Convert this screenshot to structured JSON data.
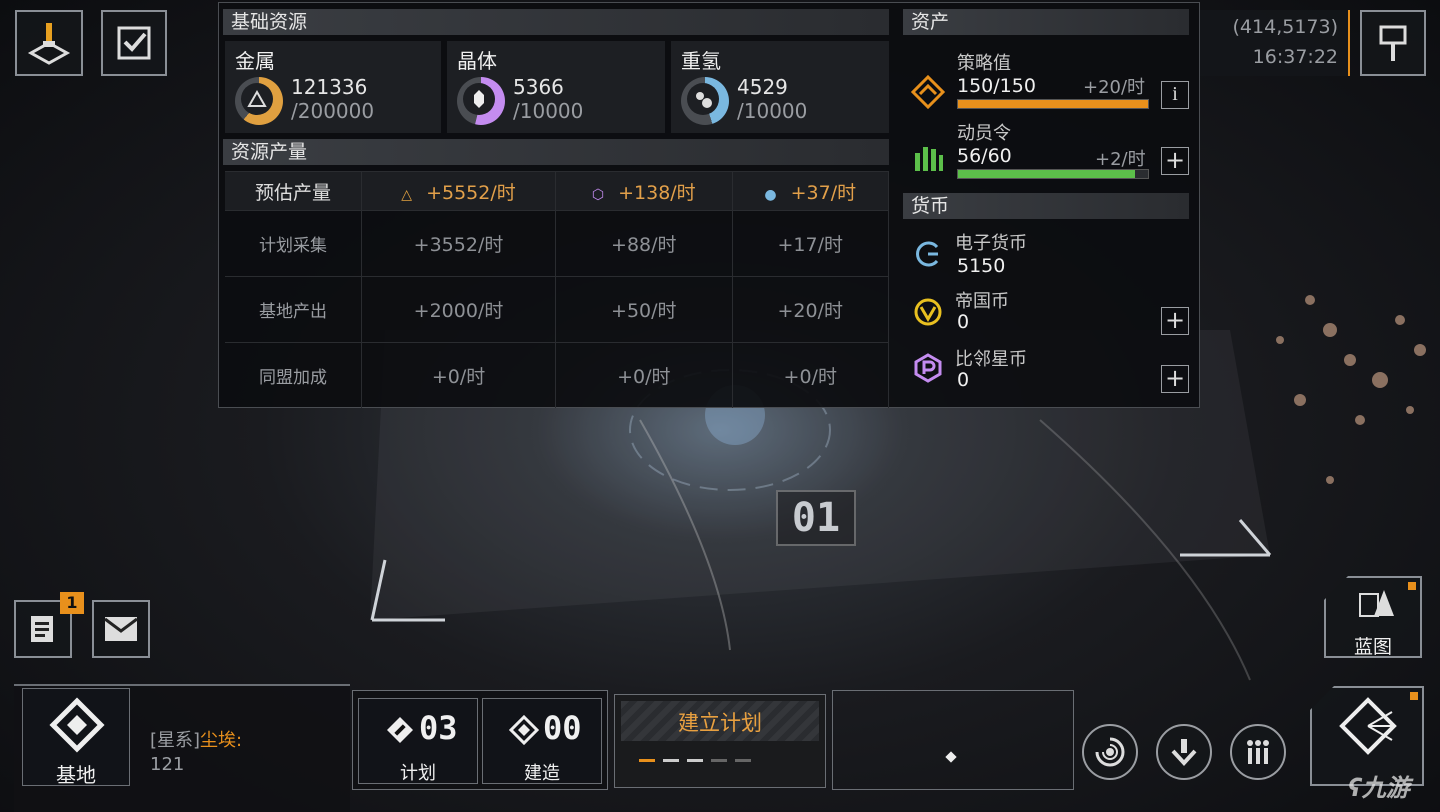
{
  "top_left": {
    "beacon_icon": "beacon-icon",
    "tasks_icon": "checklist-icon"
  },
  "top_right": {
    "coords": "(414,5173)",
    "time": "16:37:22",
    "map_pin_icon": "flag-icon"
  },
  "basic_resources": {
    "title": "基础资源",
    "items": [
      {
        "name": "金属",
        "current": "121336",
        "cap": "/200000",
        "color": "#e0a040",
        "fill": 0.61
      },
      {
        "name": "晶体",
        "current": "5366",
        "cap": "/10000",
        "color": "#c48cf0",
        "fill": 0.54
      },
      {
        "name": "重氢",
        "current": "4529",
        "cap": "/10000",
        "color": "#7ab8e0",
        "fill": 0.45
      }
    ]
  },
  "production": {
    "title": "资源产量",
    "header": {
      "label": "预估产量",
      "metal": "+5552/时",
      "crystal": "+138/时",
      "deut": "+37/时"
    },
    "rows": [
      {
        "label": "计划采集",
        "metal": "+3552/时",
        "crystal": "+88/时",
        "deut": "+17/时"
      },
      {
        "label": "基地产出",
        "metal": "+2000/时",
        "crystal": "+50/时",
        "deut": "+20/时"
      },
      {
        "label": "同盟加成",
        "metal": "+0/时",
        "crystal": "+0/时",
        "deut": "+0/时"
      }
    ]
  },
  "assets": {
    "title": "资产",
    "strategy": {
      "name": "策略值",
      "value": "150/150",
      "rate": "+20/时",
      "fill": 1.0,
      "color": "#e8901c"
    },
    "mobilize": {
      "name": "动员令",
      "value": "56/60",
      "rate": "+2/时",
      "fill": 0.93,
      "color": "#5cbf4a"
    },
    "info_label": "i",
    "plus_label": "+"
  },
  "currency": {
    "title": "货币",
    "items": [
      {
        "name": "电子货币",
        "value": "5150"
      },
      {
        "name": "帝国币",
        "value": "0"
      },
      {
        "name": "比邻星币",
        "value": "0"
      }
    ]
  },
  "scene": {
    "zone_label": "01"
  },
  "left_side": {
    "badge": "1",
    "notes_icon": "notes-icon",
    "mail_icon": "mail-icon"
  },
  "blueprint": {
    "label": "蓝图"
  },
  "bottom": {
    "base_label": "基地",
    "system_prefix": "[星系]",
    "system_name": "尘埃:",
    "system_value": "121",
    "plan_count": "03",
    "plan_label": "计划",
    "build_count": "00",
    "build_label": "建造",
    "establish_label": "建立计划",
    "watermark": "九游"
  }
}
